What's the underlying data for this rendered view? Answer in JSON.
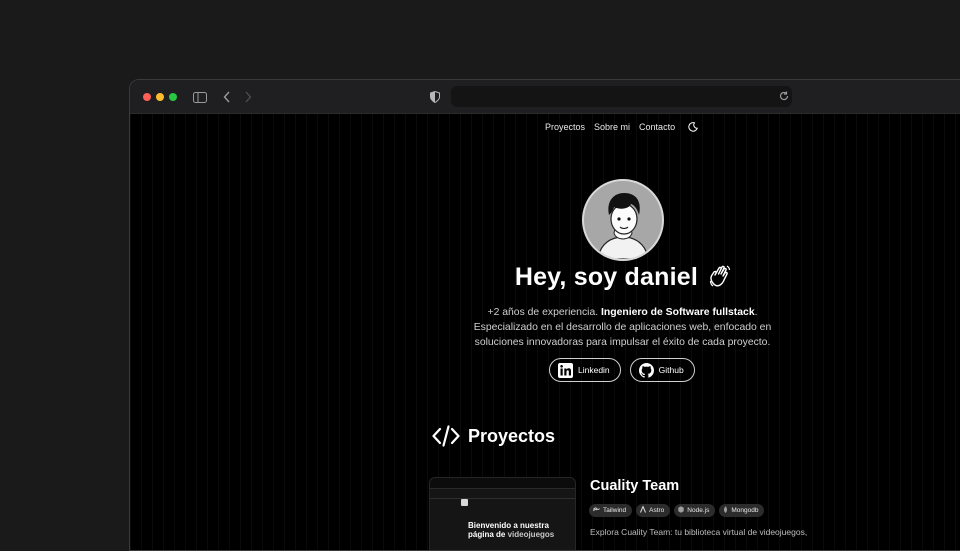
{
  "nav": {
    "projects": "Proyectos",
    "about": "Sobre mi",
    "contact": "Contacto"
  },
  "hero": {
    "title": "Hey, soy daniel",
    "desc_prefix": "+2 años de experiencia. ",
    "desc_bold": "Ingeniero de Software fullstack",
    "desc_suffix": ". Especializado en el desarrollo de aplicaciones web, enfocado en soluciones innovadoras para impulsar el éxito de cada proyecto."
  },
  "social": {
    "linkedin": "Linkedin",
    "github": "Github"
  },
  "projects": {
    "heading": "Proyectos",
    "items": [
      {
        "title": "Cuality Team",
        "thumb_line1": "Bienvenido a nuestra",
        "thumb_line2a": "página de ",
        "thumb_line2b": "videojuegos",
        "tags": [
          "Tailwind",
          "Astro",
          "Node.js",
          "Mongodb"
        ],
        "desc": "Explora Cuality Team: tu biblioteca virtual de videojuegos,"
      }
    ]
  },
  "icons": {
    "theme": "moon-icon",
    "wave": "waving-hand-icon",
    "code": "code-icon"
  },
  "colors": {
    "page_bg": "#000000",
    "desktop_bg": "#1a1a1b",
    "traffic_red": "#ff5f57",
    "traffic_yellow": "#febc2e",
    "traffic_green": "#28c840"
  }
}
